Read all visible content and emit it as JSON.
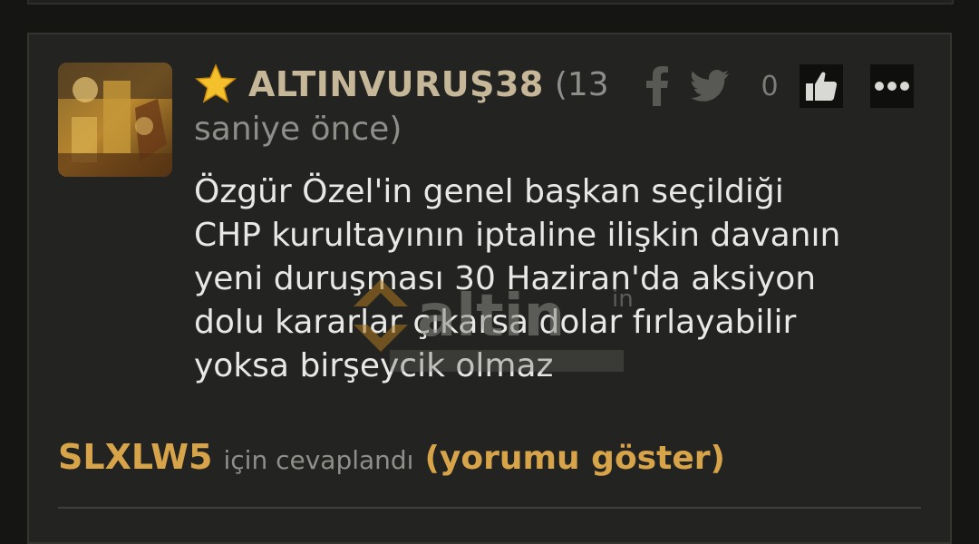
{
  "comment": {
    "username": "ALTINVURUŞ38",
    "time_line1": "(13",
    "time_line2": "saniye önce)",
    "like_count": "0",
    "body_lines": [
      "Özgür Özel'in genel başkan seçildiği",
      "CHP kurultayının iptaline ilişkin davanın",
      "yeni duruşması 30 Haziran'da aksiyon",
      "dolu kararlar çıkarsa dolar fırlayabilir",
      "yoksa birşeycik olmaz"
    ]
  },
  "reply": {
    "reply_to_user": "SLXLW5",
    "reply_text": "için cevaplandı",
    "show_link": "(yorumu göster)"
  },
  "watermark": {
    "brand": "altin",
    "suffix": "in"
  },
  "icons": {
    "star": "star-icon",
    "facebook": "facebook-icon",
    "twitter": "twitter-icon",
    "like": "thumbs-up-icon",
    "more": "more-icon"
  },
  "colors": {
    "username": "#c6b799",
    "reply_accent": "#d8a44a",
    "background": "#151513",
    "card": "#232321"
  }
}
